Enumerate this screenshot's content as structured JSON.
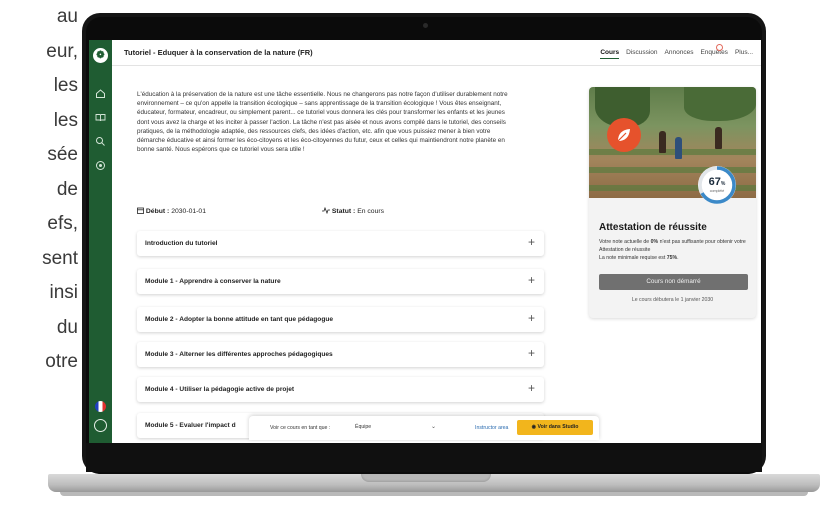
{
  "side_paragraph": [
    "au",
    "eur,",
    "les",
    "les",
    "sée",
    "de",
    "efs,",
    "sent",
    "insi",
    "du",
    "otre"
  ],
  "app": {
    "logo_glyph": "❁",
    "course_title": "Tutoriel - Eduquer à la conservation de la nature (FR)",
    "nav": [
      "Cours",
      "Discussion",
      "Annonces",
      "Enquêtes",
      "Plus..."
    ],
    "description": "L'éducation à la préservation de la nature est une tâche essentielle. Nous ne changerons pas notre façon d'utiliser durablement notre environnement – ce qu'on appelle la transition écologique – sans apprentissage de la transition écologique ! Vous êtes enseignant, éducateur, formateur, encadreur, ou simplement parent... ce tutoriel vous donnera les clés pour transformer les enfants et les jeunes dont vous avez la charge et les inciter à passer l'action. La tâche n'est pas aisée et nous avons compilé dans le tutoriel, des conseils pratiques, de la méthodologie adaptée, des ressources clefs, des idées d'action, etc. afin que vous puissiez mener à bien votre démarche éducative et ainsi former les éco-citoyens et les éco-citoyennes du futur, ceux et celles qui maintiendront notre planète en bonne santé. Nous espérons que ce tutoriel vous sera utile !",
    "start_label": "Début :",
    "start_value": "2030-01-01",
    "status_label": "Statut :",
    "status_value": "En cours",
    "modules": [
      "Introduction du tutoriel",
      "Module 1 - Apprendre à conserver la nature",
      "Module 2 - Adopter la bonne attitude en tant que pédagogue",
      "Module 3 - Alterner les différentes approches pédagogiques",
      "Module 4 - Utiliser la pédagogie active de projet",
      "Module 5 - Evaluer l'impact d"
    ],
    "expand_glyph": "+",
    "certificate": {
      "progress_percent": 67,
      "progress_number": "67",
      "progress_unit": "%",
      "progress_caption": "complété",
      "title": "Attestation de réussite",
      "text_part1": "Votre note actuelle de ",
      "current_grade": "0%",
      "text_part2": " n'est pas suffisante pour obtenir votre Attestation de réussite",
      "text_part3": "La note minimale requise est ",
      "min_grade": "75%",
      "text_part4": ".",
      "button_label": "Cours non démarré",
      "footnote": "Le cours débutera le 1 janvier 2030",
      "accent_color": "#e6522c",
      "ring_color": "#3b89c8"
    },
    "bottom_bar": {
      "view_label": "Voir ce cours en tant que :",
      "view_value": "Équipe",
      "instructor_link": "Instructor area",
      "studio_button": "◉ Voir dans Studio"
    },
    "sidebar_color": "#1f5c32",
    "sidebar_icons": [
      "home-icon",
      "book-icon",
      "search-icon",
      "radio-icon"
    ]
  }
}
